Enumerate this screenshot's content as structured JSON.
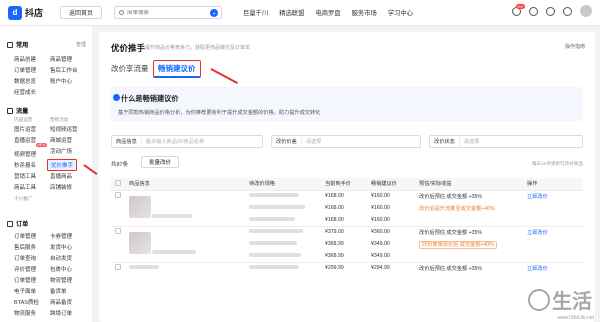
{
  "topbar": {
    "logo_text": "抖店",
    "home_label": "返回首页",
    "search_placeholder": "简单搜索",
    "nav": [
      "巨量千川",
      "精选联盟",
      "电商罗盘",
      "服务市场",
      "学习中心"
    ],
    "badge": "99+"
  },
  "sidebar": {
    "group_common": "常用",
    "manage": "管理",
    "common_items": [
      "商品创建",
      "商品管理",
      "订单管理",
      "售后工作台",
      "数据总览",
      "账户中心",
      "经营成长"
    ],
    "group_traffic": "流量",
    "sub_content": "内容运营",
    "sub_activity": "营销活动",
    "traffic_items": [
      "图片运营",
      "直播运营",
      "短视频运营",
      "视频管理",
      "活动广场",
      "商城运营",
      "秒杀报名",
      "优价推手",
      "直播商品",
      "营销工具",
      "商品工具",
      "店铺装修"
    ],
    "new_badge": "NEW",
    "sub_qc": "千川推广",
    "group_order": "订单",
    "order_items": [
      "订单管理",
      "售后服务",
      "订单查询",
      "评价管理",
      "订单管理",
      "电子面单",
      "BTAS质检",
      "物流服务",
      "极速退款"
    ],
    "order_items_right": [
      "卡券管理",
      "发货中心",
      "自动发货",
      "包裹中心",
      "物流管理",
      "备货单",
      "商品备货",
      "跨境订单",
      "订单售后"
    ]
  },
  "main": {
    "title": "优价推手",
    "desc": "提升商品价格竞争力，获取更商品曝光及订单单",
    "help": "操作指南",
    "tab1": "改价享流量",
    "tab2": "畅销建议价",
    "info_title": "什么是畅销建议价",
    "info_desc": "基于同款热销商品价格分析，为你推荐更有利于提升成交金额的价格，助力提升成交转化",
    "filter1_label": "商品信息",
    "filter1_placeholder": "最多输入商品ID/商品名称",
    "filter2_label": "改价价差",
    "filter2_placeholder": "请选择",
    "filter3_label": "改价状态",
    "filter3_placeholder": "请选择",
    "total": "共87条",
    "batch": "批量改价",
    "refresh": "每天10点更新可改价商品",
    "columns": [
      "商品信息",
      "待改价规格",
      "当前到手价",
      "畅销建议价",
      "预估/实际收益",
      "操作"
    ],
    "rows": [
      {
        "cur": "¥168.00",
        "sug": "¥160.00",
        "est": "改价后预估 成交金额 +35%",
        "promo": "改价后提升流量至成交金额+40%",
        "op": "立即改价",
        "sub": false
      },
      {
        "cur": "¥168.00",
        "sug": "¥160.00",
        "est": "",
        "promo": "",
        "op": "",
        "sub": true
      },
      {
        "cur": "¥168.00",
        "sug": "¥160.00",
        "est": "",
        "promo": "",
        "op": "",
        "sub": true
      },
      {
        "cur": "¥379.00",
        "sug": "¥360.00",
        "est": "改价后预估 成交金额 +35%",
        "promo": "",
        "op": "立即改价",
        "sub": false
      },
      {
        "cur": "¥368.99",
        "sug": "¥349.00",
        "est": "",
        "promo": "同价商家改价后 成交金额+40%",
        "op": "",
        "sub": true
      },
      {
        "cur": "¥368.99",
        "sug": "¥349.00",
        "est": "",
        "promo": "",
        "op": "",
        "sub": true
      },
      {
        "cur": "¥299.99",
        "sug": "¥294.99",
        "est": "改价后预估 成交金额 +35%",
        "promo": "",
        "op": "立即改价",
        "sub": false
      }
    ]
  },
  "watermark": {
    "text": "生活",
    "url": "www.iShiLife.net"
  },
  "colors": {
    "accent": "#1966ff",
    "highlight": "#e8312f",
    "promo": "#f07d26"
  }
}
